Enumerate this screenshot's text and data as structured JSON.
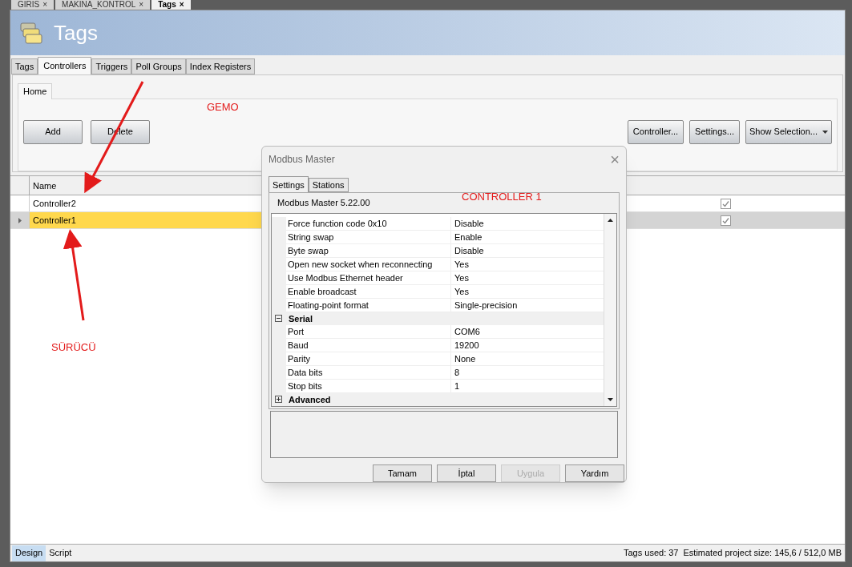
{
  "doc_tabs": [
    {
      "label": "GIRIS",
      "close": "×",
      "selected": false
    },
    {
      "label": "MAKINA_KONTROL",
      "close": "×",
      "selected": false
    },
    {
      "label": "Tags",
      "close": "×",
      "selected": true
    }
  ],
  "page_header": {
    "title": "Tags"
  },
  "tabs": [
    {
      "label": "Tags",
      "selected": false
    },
    {
      "label": "Controllers",
      "selected": true
    },
    {
      "label": "Triggers",
      "selected": false
    },
    {
      "label": "Poll Groups",
      "selected": false
    },
    {
      "label": "Index Registers",
      "selected": false
    }
  ],
  "ribbon": {
    "tabs": [
      {
        "label": "Home",
        "selected": true
      }
    ],
    "left_buttons": [
      "Add",
      "Delete"
    ],
    "right_buttons": [
      {
        "label": "Controller...",
        "kind": "plain"
      },
      {
        "label": "Settings...",
        "kind": "plain"
      },
      {
        "label": "Show Selection...",
        "kind": "dropdown"
      }
    ]
  },
  "grid": {
    "columns": [
      "Name"
    ],
    "rows": [
      {
        "name": "Controller2",
        "checked": true,
        "selected": false
      },
      {
        "name": "Controller1",
        "checked": true,
        "selected": true
      }
    ]
  },
  "annotations": [
    {
      "text": "GEMO"
    },
    {
      "text": "CONTROLLER 1"
    },
    {
      "text": "SÜRÜCÜ"
    }
  ],
  "dialog": {
    "title": "Modbus Master",
    "close": "×",
    "tabs": [
      {
        "label": "Settings",
        "selected": true
      },
      {
        "label": "Stations",
        "selected": false
      }
    ],
    "subtitle": "Modbus Master 5.22.00",
    "properties": [
      {
        "kind": "row",
        "name": "Force function code 0x10",
        "value": "Disable"
      },
      {
        "kind": "row",
        "name": "String swap",
        "value": "Enable"
      },
      {
        "kind": "row",
        "name": "Byte swap",
        "value": "Disable"
      },
      {
        "kind": "row",
        "name": "Open new socket when reconnecting",
        "value": "Yes"
      },
      {
        "kind": "row",
        "name": "Use Modbus Ethernet header",
        "value": "Yes"
      },
      {
        "kind": "row",
        "name": "Enable broadcast",
        "value": "Yes"
      },
      {
        "kind": "row",
        "name": "Floating-point format",
        "value": "Single-precision"
      },
      {
        "kind": "category",
        "name": "Serial",
        "expanded": true
      },
      {
        "kind": "row",
        "name": "Port",
        "value": "COM6"
      },
      {
        "kind": "row",
        "name": "Baud",
        "value": "19200"
      },
      {
        "kind": "row",
        "name": "Parity",
        "value": "None"
      },
      {
        "kind": "row",
        "name": "Data bits",
        "value": "8"
      },
      {
        "kind": "row",
        "name": "Stop bits",
        "value": "1"
      },
      {
        "kind": "category",
        "name": "Advanced",
        "expanded": false
      }
    ],
    "buttons": [
      {
        "label": "Tamam",
        "disabled": false
      },
      {
        "label": "İptal",
        "disabled": false
      },
      {
        "label": "Uygula",
        "disabled": true
      },
      {
        "label": "Yardım",
        "disabled": false
      }
    ]
  },
  "status_bar": {
    "views": [
      {
        "label": "Design",
        "selected": true
      },
      {
        "label": "Script",
        "selected": false
      }
    ],
    "info": [
      "Tags used: 37",
      "Estimated project size: 145,6 / 512,0 MB"
    ]
  }
}
